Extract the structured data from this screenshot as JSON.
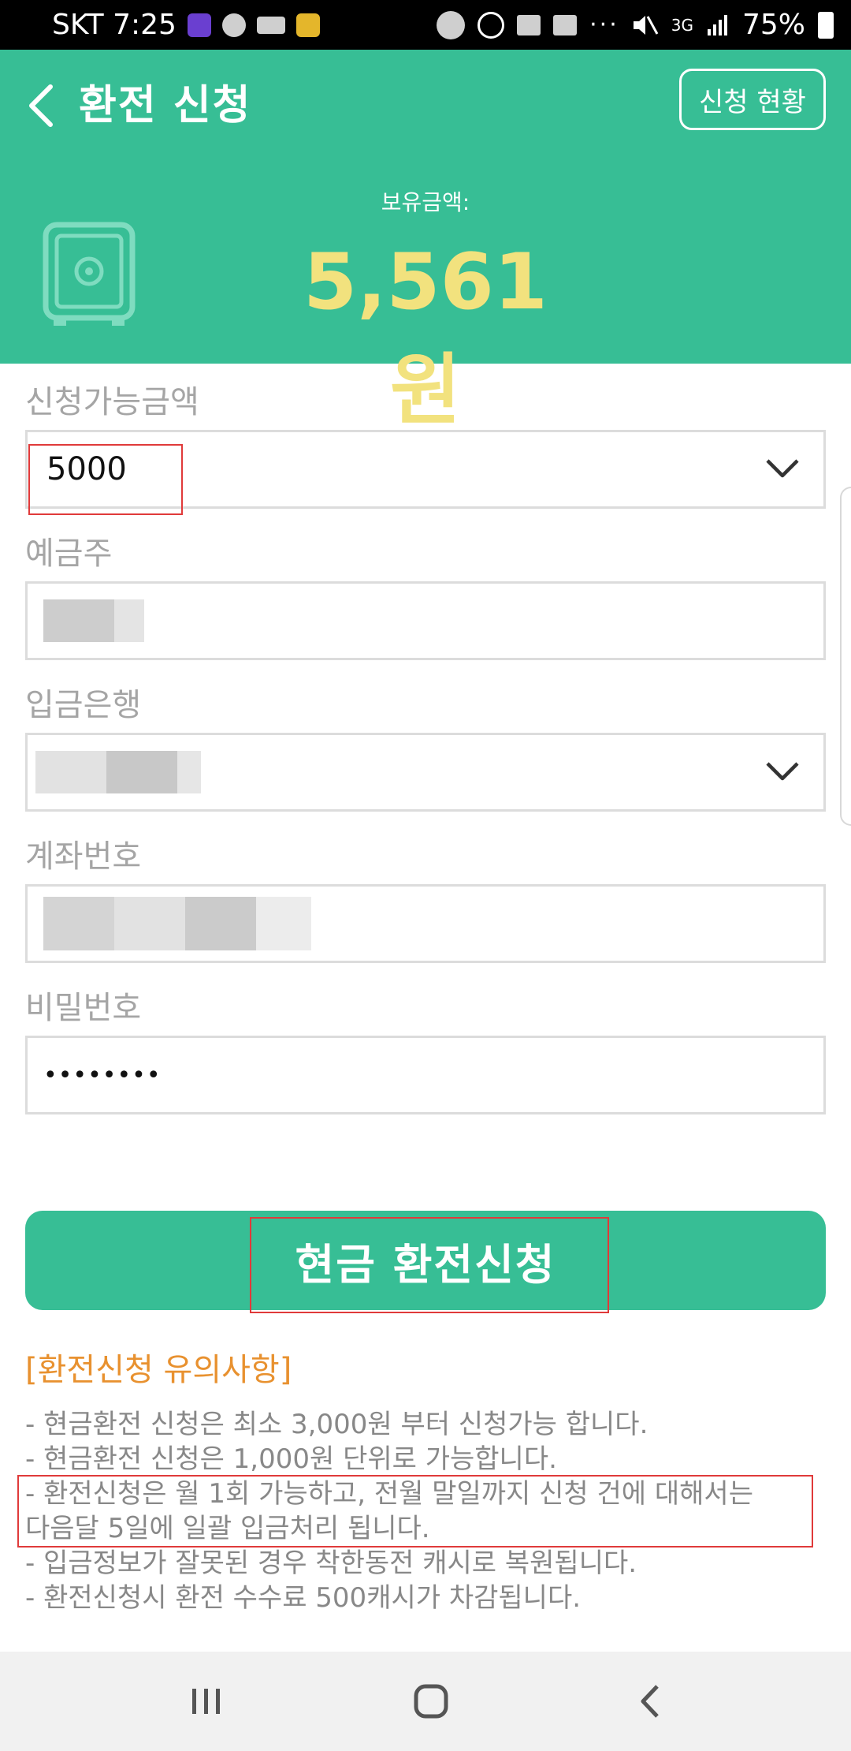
{
  "status_bar": {
    "carrier_time": "SKT 7:25",
    "network": "3G",
    "battery": "75%",
    "more": "···"
  },
  "header": {
    "title": "환전 신청",
    "status_button": "신청 현황",
    "balance_label": "보유금액:",
    "balance_value": "5,561원",
    "bg_color": "#37be95",
    "balance_color": "#f2e27e"
  },
  "form": {
    "amount": {
      "label": "신청가능금액",
      "value": "5000"
    },
    "holder": {
      "label": "예금주"
    },
    "bank": {
      "label": "입금은행"
    },
    "account": {
      "label": "계좌번호"
    },
    "password": {
      "label": "비밀번호",
      "value": "••••••••"
    }
  },
  "submit_button": "현금 환전신청",
  "notice": {
    "title": "[환전신청 유의사항]",
    "lines": [
      "- 현금환전 신청은 최소 3,000원 부터 신청가능 합니다.",
      "- 현금환전 신청은 1,000원 단위로 가능합니다.",
      "- 환전신청은 월 1회 가능하고, 전월 말일까지 신청 건에 대해서는",
      "다음달 5일에 일괄 입금처리 됩니다.",
      "- 입금정보가 잘못된 경우 착한동전 캐시로 복원됩니다.",
      "- 환전신청시 환전 수수료 500캐시가 차감됩니다."
    ],
    "title_color": "#e8912f"
  }
}
